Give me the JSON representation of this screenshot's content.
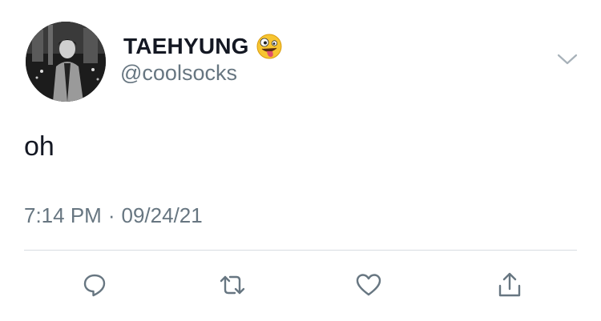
{
  "tweet": {
    "author": {
      "display_name": "TAEHYUNG",
      "name_emoji": "zany-face-emoji",
      "handle": "@coolsocks",
      "avatar": "profile-photo"
    },
    "text": "oh",
    "time": "7:14 PM",
    "separator": "·",
    "date": "09/24/21"
  },
  "actions": [
    {
      "name": "reply",
      "icon": "reply-icon"
    },
    {
      "name": "retweet",
      "icon": "retweet-icon"
    },
    {
      "name": "like",
      "icon": "heart-icon"
    },
    {
      "name": "share",
      "icon": "share-icon"
    }
  ],
  "menu": {
    "icon": "chevron-down-icon"
  },
  "colors": {
    "primary_text": "#141823",
    "secondary_text": "#677681",
    "icon": "#677681",
    "divider": "#d8dde2",
    "background": "#ffffff"
  }
}
